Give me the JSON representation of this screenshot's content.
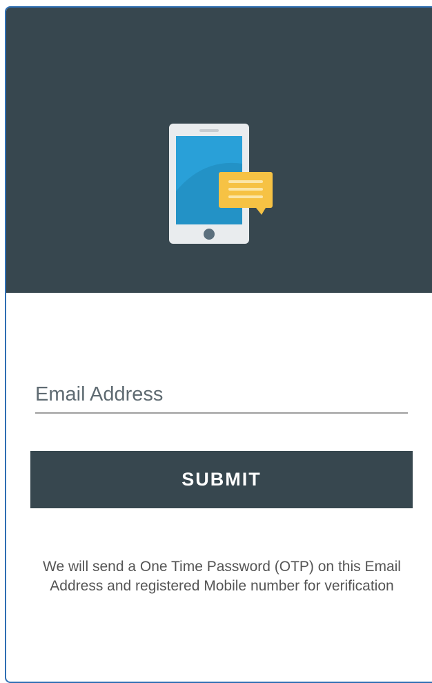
{
  "header": {
    "illustration_icon": "phone-message-icon",
    "background_color": "#37474f"
  },
  "form": {
    "email": {
      "placeholder": "Email Address",
      "value": ""
    },
    "submit_label": "SUBMIT",
    "info_text": "We will send a One Time Password (OTP) on this Email Address and registered Mobile number for verification"
  },
  "colors": {
    "primary": "#37474f",
    "phone_screen": "#29a0d8",
    "message_bubble": "#f6c244",
    "frame_border": "#2f6fb3"
  }
}
